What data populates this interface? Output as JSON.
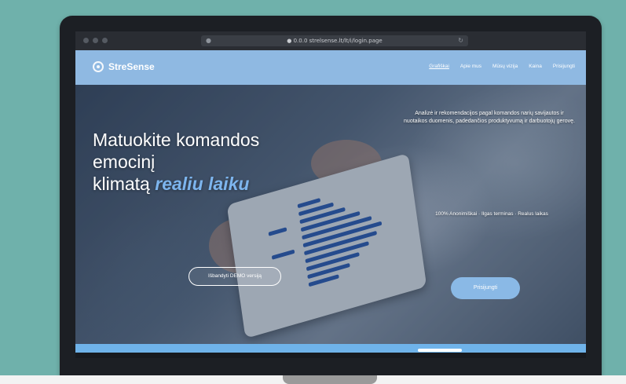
{
  "browser": {
    "url": "● 0.0.0 strelsense.lt/lt/i/login.page"
  },
  "brand": {
    "name": "StreSense"
  },
  "nav": {
    "items": [
      {
        "label": "Grafiškai",
        "active": true
      },
      {
        "label": "Apie mus",
        "active": false
      },
      {
        "label": "Mūsų vizija",
        "active": false
      },
      {
        "label": "Kaina",
        "active": false
      },
      {
        "label": "Prisijungti",
        "active": false
      }
    ]
  },
  "hero": {
    "headline_line1": "Matuokite komandos",
    "headline_line2": "emocinį",
    "headline_line3_plain": "klimatą ",
    "headline_line3_accent": "realiu laiku",
    "right_copy": "Analizė ir rekomendacijos pagal komandos narių savijautos ir nuotaikos duomenis, padedančios produktyvumą ir darbuotojų gerovę.",
    "features": "100% Anonimiškai · Ilgas terminas · Realus laikas",
    "demo_button": "Išbandyti DEMO versiją",
    "signup_button": "Prisijungti"
  },
  "colors": {
    "frame_bg": "#6fb1ab",
    "nav_bg": "#8fb9e2",
    "accent": "#7db5ee",
    "bottom_bar": "#6fb3ea"
  }
}
